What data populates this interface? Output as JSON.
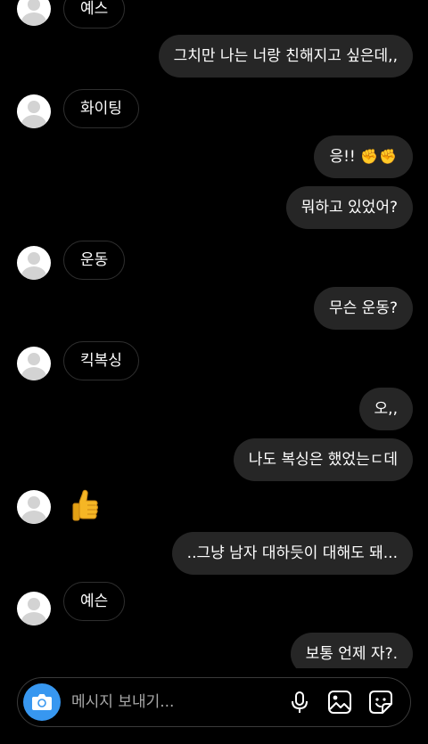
{
  "messages": [
    {
      "dir": "in",
      "text": "예스"
    },
    {
      "dir": "out",
      "text": "그치만 나는 너랑 친해지고 싶은데,,"
    },
    {
      "dir": "in",
      "text": "화이팅"
    },
    {
      "dir": "out",
      "text": "응!!",
      "emoji": "✊✊"
    },
    {
      "dir": "out",
      "text": "뭐하고 있었어?"
    },
    {
      "dir": "in",
      "text": "운동"
    },
    {
      "dir": "out",
      "text": "무슨 운동?"
    },
    {
      "dir": "in",
      "text": "킥복싱"
    },
    {
      "dir": "out",
      "text": "오,,"
    },
    {
      "dir": "out",
      "text": "나도 복싱은 했었는ㄷ데"
    },
    {
      "dir": "in",
      "text": "",
      "icon": "thumbs-up-emoji"
    },
    {
      "dir": "out",
      "text": "..그냥 남자 대하듯이 대해도 돼..."
    },
    {
      "dir": "in",
      "text": "예슨"
    },
    {
      "dir": "out",
      "text": "보통 언제 자?."
    }
  ],
  "composer": {
    "placeholder": "메시지 보내기...",
    "icons": [
      "camera-icon",
      "microphone-icon",
      "gallery-icon",
      "sticker-icon"
    ],
    "accent": "#3797f0"
  },
  "colors": {
    "background": "#000000",
    "outgoing_bubble": "#262626",
    "incoming_border": "#2f2f2f",
    "text": "#ffffff"
  }
}
